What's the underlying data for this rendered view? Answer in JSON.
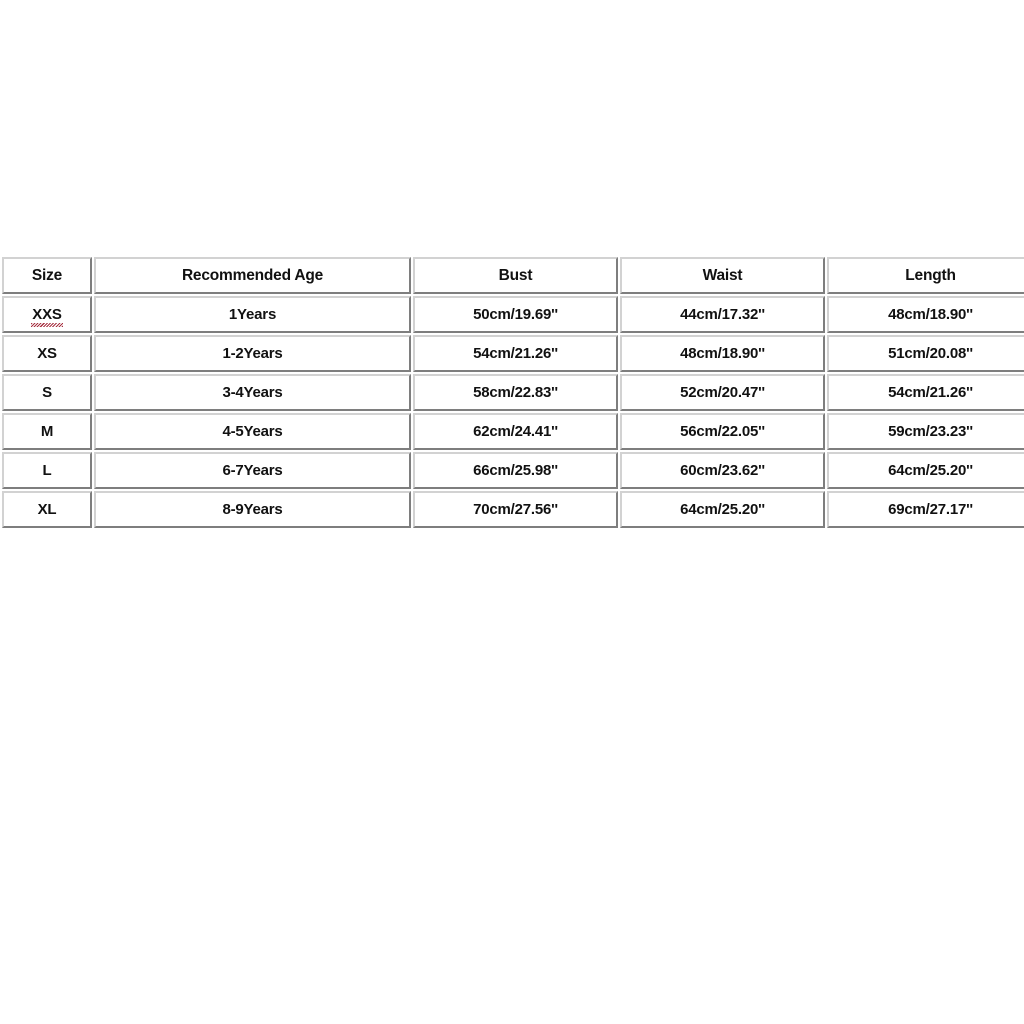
{
  "page": {
    "background_color": "#ffffff",
    "text_color": "#111111",
    "cell_border_color": "#d2d2d2",
    "spellcheck_underline_color": "#a32638"
  },
  "size_chart": {
    "columns": [
      {
        "key": "size",
        "label": "Size"
      },
      {
        "key": "age",
        "label": "Recommended Age"
      },
      {
        "key": "bust",
        "label": "Bust"
      },
      {
        "key": "waist",
        "label": "Waist"
      },
      {
        "key": "length",
        "label": "Length"
      }
    ],
    "rows": [
      {
        "size": "XXS",
        "size_misspelled": true,
        "age": "1Years",
        "bust": "50cm/19.69''",
        "waist": "44cm/17.32''",
        "length": "48cm/18.90''"
      },
      {
        "size": "XS",
        "size_misspelled": false,
        "age": "1-2Years",
        "bust": "54cm/21.26''",
        "waist": "48cm/18.90''",
        "length": "51cm/20.08''"
      },
      {
        "size": "S",
        "size_misspelled": false,
        "age": "3-4Years",
        "bust": "58cm/22.83''",
        "waist": "52cm/20.47''",
        "length": "54cm/21.26''"
      },
      {
        "size": "M",
        "size_misspelled": false,
        "age": "4-5Years",
        "bust": "62cm/24.41''",
        "waist": "56cm/22.05''",
        "length": "59cm/23.23''"
      },
      {
        "size": "L",
        "size_misspelled": false,
        "age": "6-7Years",
        "bust": "66cm/25.98''",
        "waist": "60cm/23.62''",
        "length": "64cm/25.20''"
      },
      {
        "size": "XL",
        "size_misspelled": false,
        "age": "8-9Years",
        "bust": "70cm/27.56''",
        "waist": "64cm/25.20''",
        "length": "69cm/27.17''"
      }
    ]
  }
}
